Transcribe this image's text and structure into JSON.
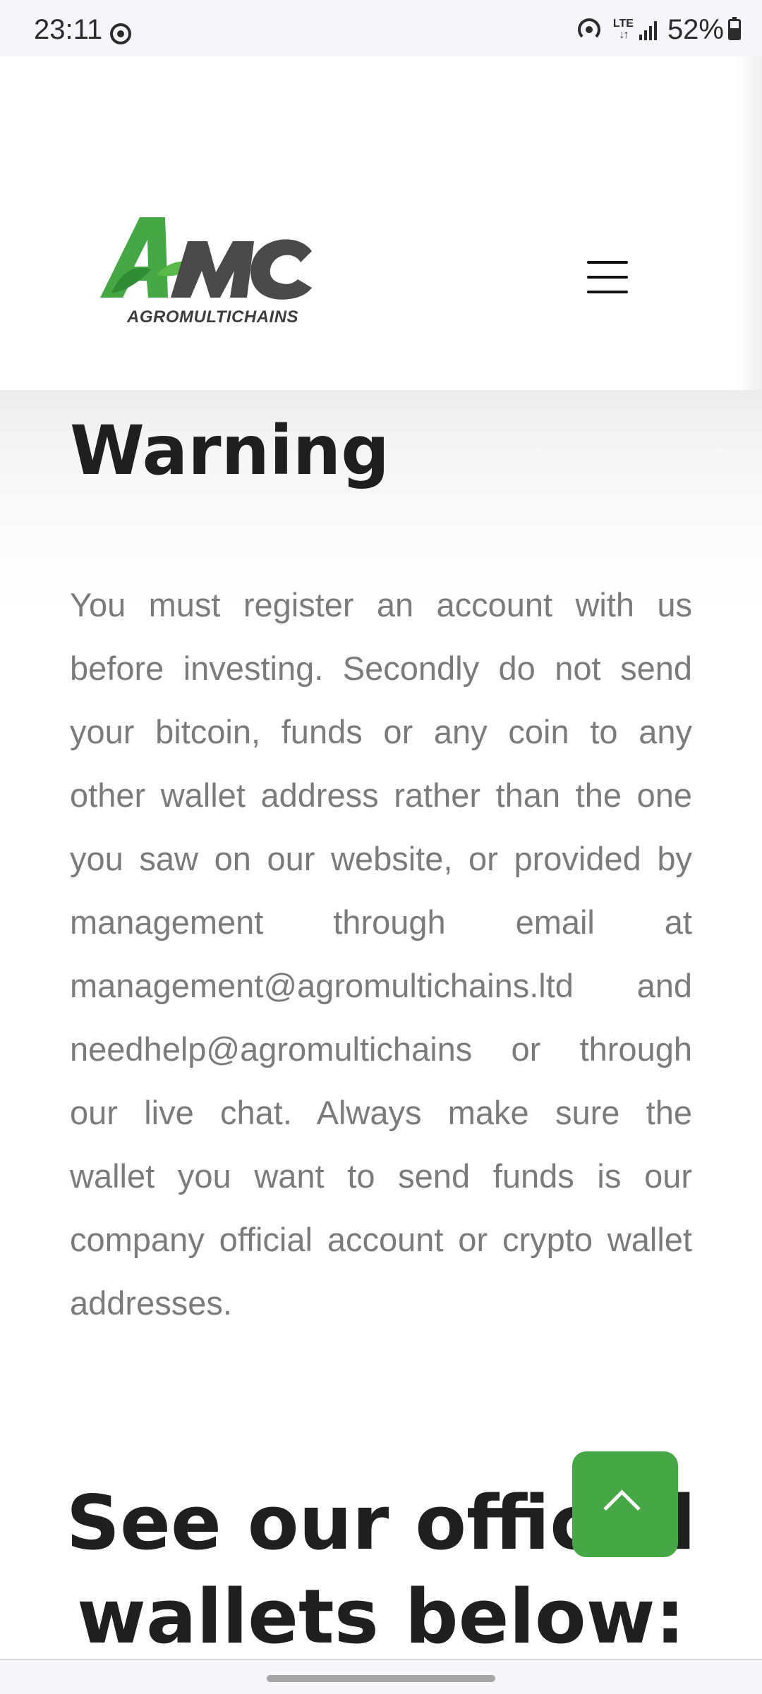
{
  "status_bar": {
    "time": "23:11",
    "network": "LTE",
    "battery_percent": "52%",
    "icons": [
      "messenger-icon",
      "hotspot-icon",
      "lte-icon",
      "signal-icon",
      "battery-icon"
    ]
  },
  "header": {
    "logo_text": "AGROMULTICHAINS",
    "logo_mark": "AMC",
    "menu_icon": "hamburger-menu-icon"
  },
  "warning": {
    "heading": "Warning",
    "body": "You must register an account with us before investing. Secondly do not send your bitcoin, funds or any coin to any other wallet address rather than the one you saw on our website, or provided by management through email at management@agromultichains.ltd and needhelp@agromultichains or through our live chat. Always make sure the wallet you want to send funds is our company official account or crypto wallet addresses."
  },
  "wallets": {
    "heading": "See our official wallets below:"
  },
  "scroll_top": {
    "icon": "chevron-up-icon"
  },
  "colors": {
    "brand_green": "#45a844",
    "logo_gray": "#4a4a4a",
    "heading": "#1f1f1f",
    "body_text": "#7b7b7b"
  }
}
